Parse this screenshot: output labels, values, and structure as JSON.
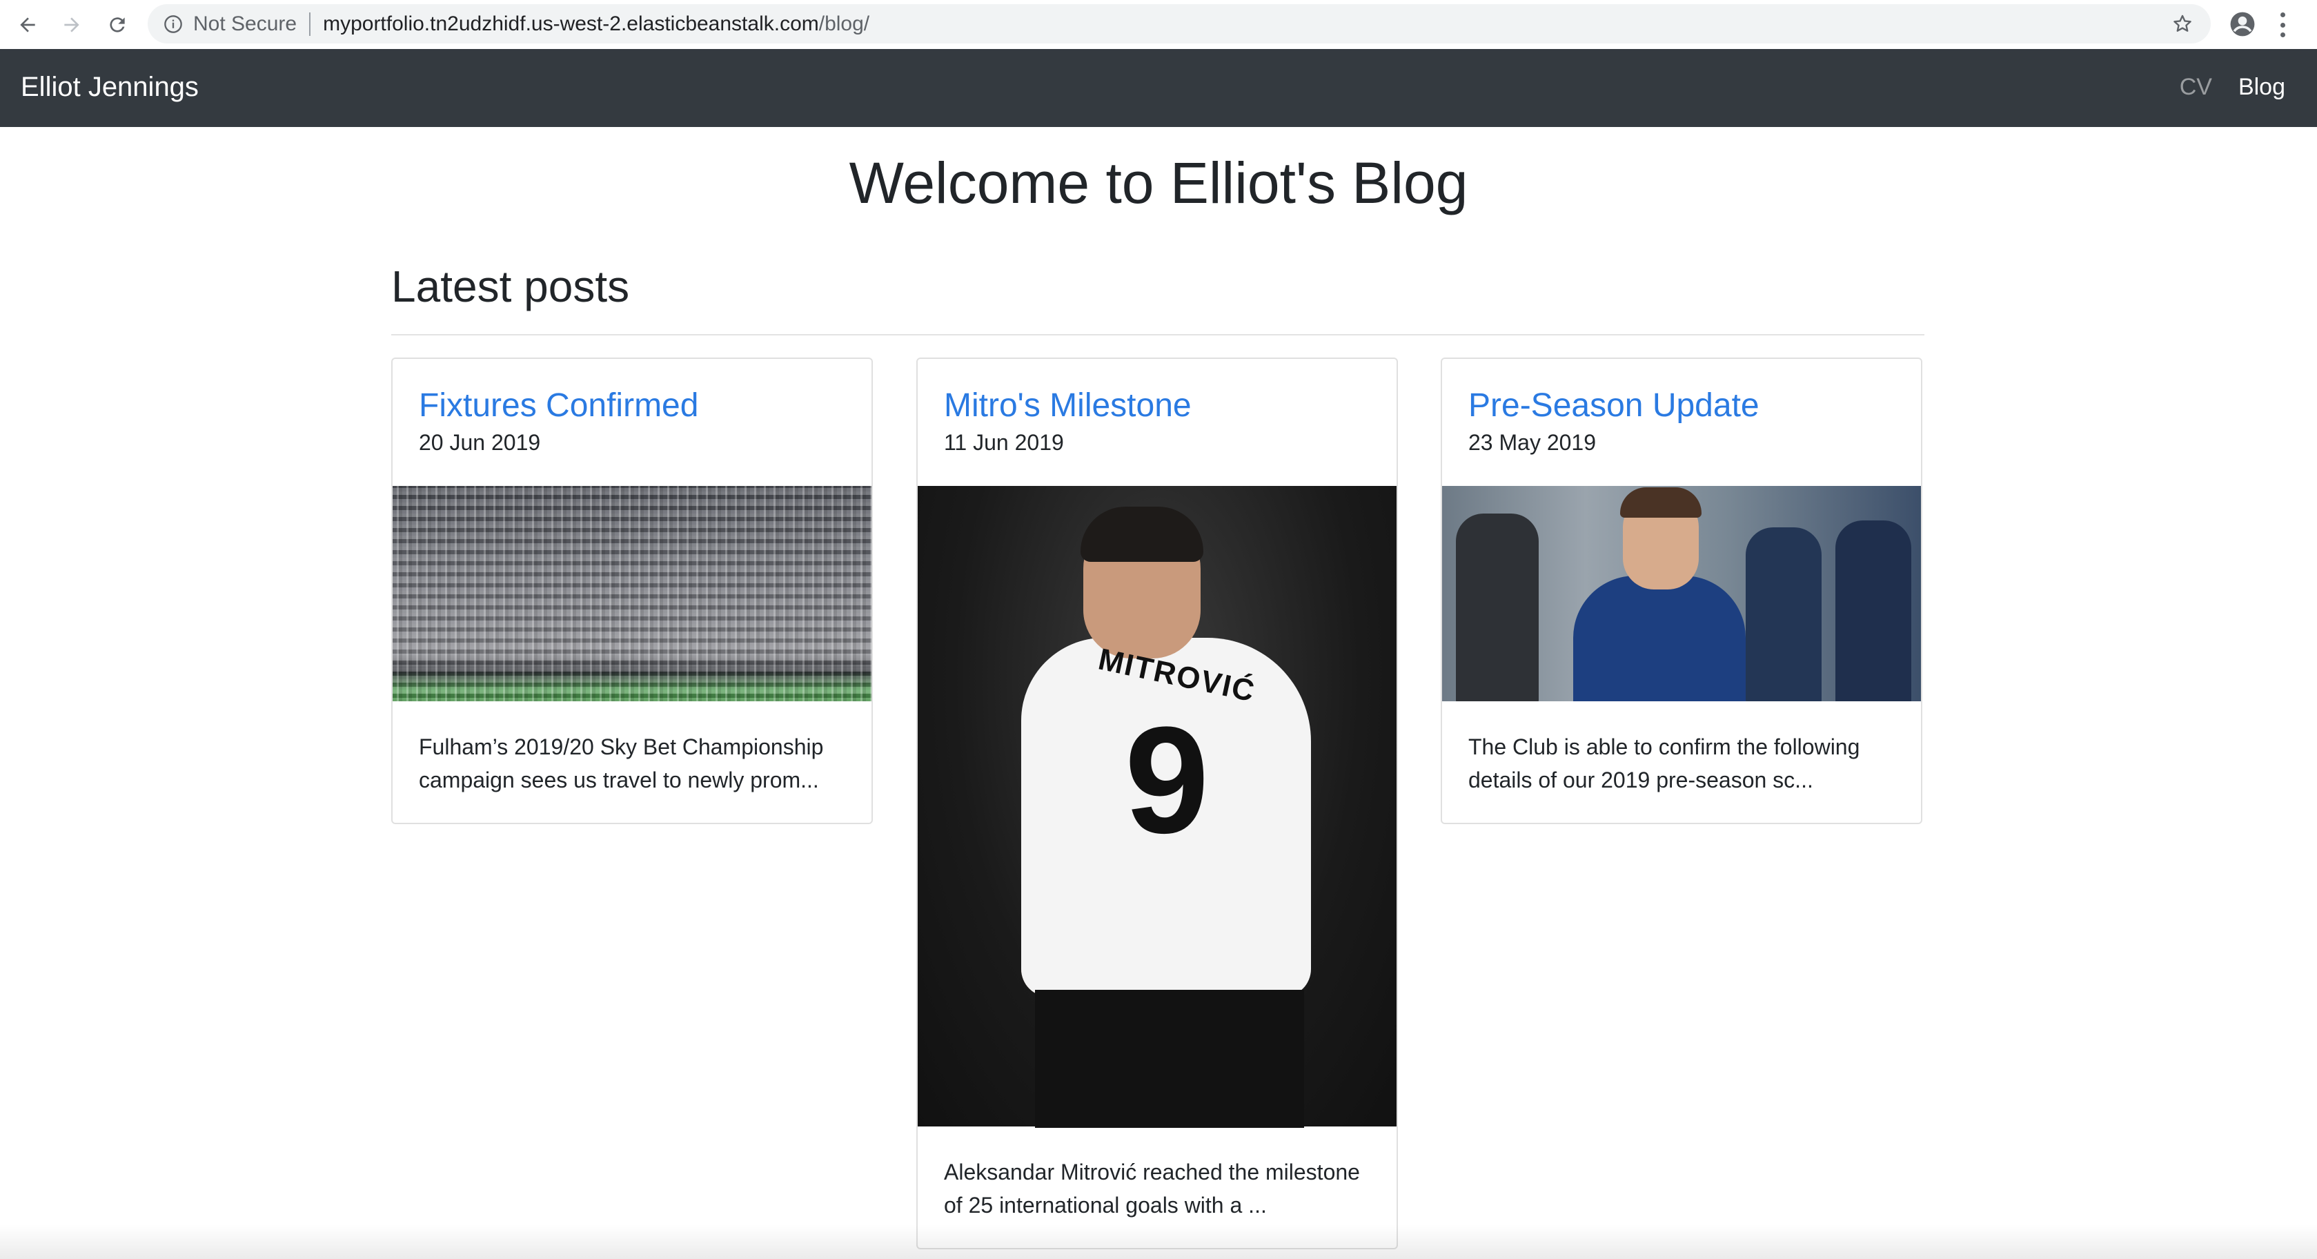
{
  "browser": {
    "security_label": "Not Secure",
    "url_host": "myportfolio.tn2udzhidf.us-west-2.elasticbeanstalk.com",
    "url_path": "/blog/"
  },
  "navbar": {
    "brand": "Elliot Jennings",
    "links": [
      {
        "label": "CV"
      },
      {
        "label": "Blog"
      }
    ]
  },
  "page": {
    "title": "Welcome to Elliot's Blog",
    "section_title": "Latest posts"
  },
  "posts": [
    {
      "title": "Fixtures Confirmed",
      "date": "20 Jun 2019",
      "excerpt_line1": "Fulham’s 2019/20 Sky Bet Championship",
      "excerpt_line2": "campaign sees us travel to newly prom..."
    },
    {
      "title": "Mitro's Milestone",
      "date": "11 Jun 2019",
      "image_text_name": "MITROVIĆ",
      "image_text_number": "9",
      "excerpt_line1": "Aleksandar Mitrović reached the milestone",
      "excerpt_line2": "of 25 international goals with a ..."
    },
    {
      "title": "Pre-Season Update",
      "date": "23 May 2019",
      "excerpt_line1": "The Club is able to confirm the following",
      "excerpt_line2": "details of our 2019 pre-season sc..."
    }
  ]
}
